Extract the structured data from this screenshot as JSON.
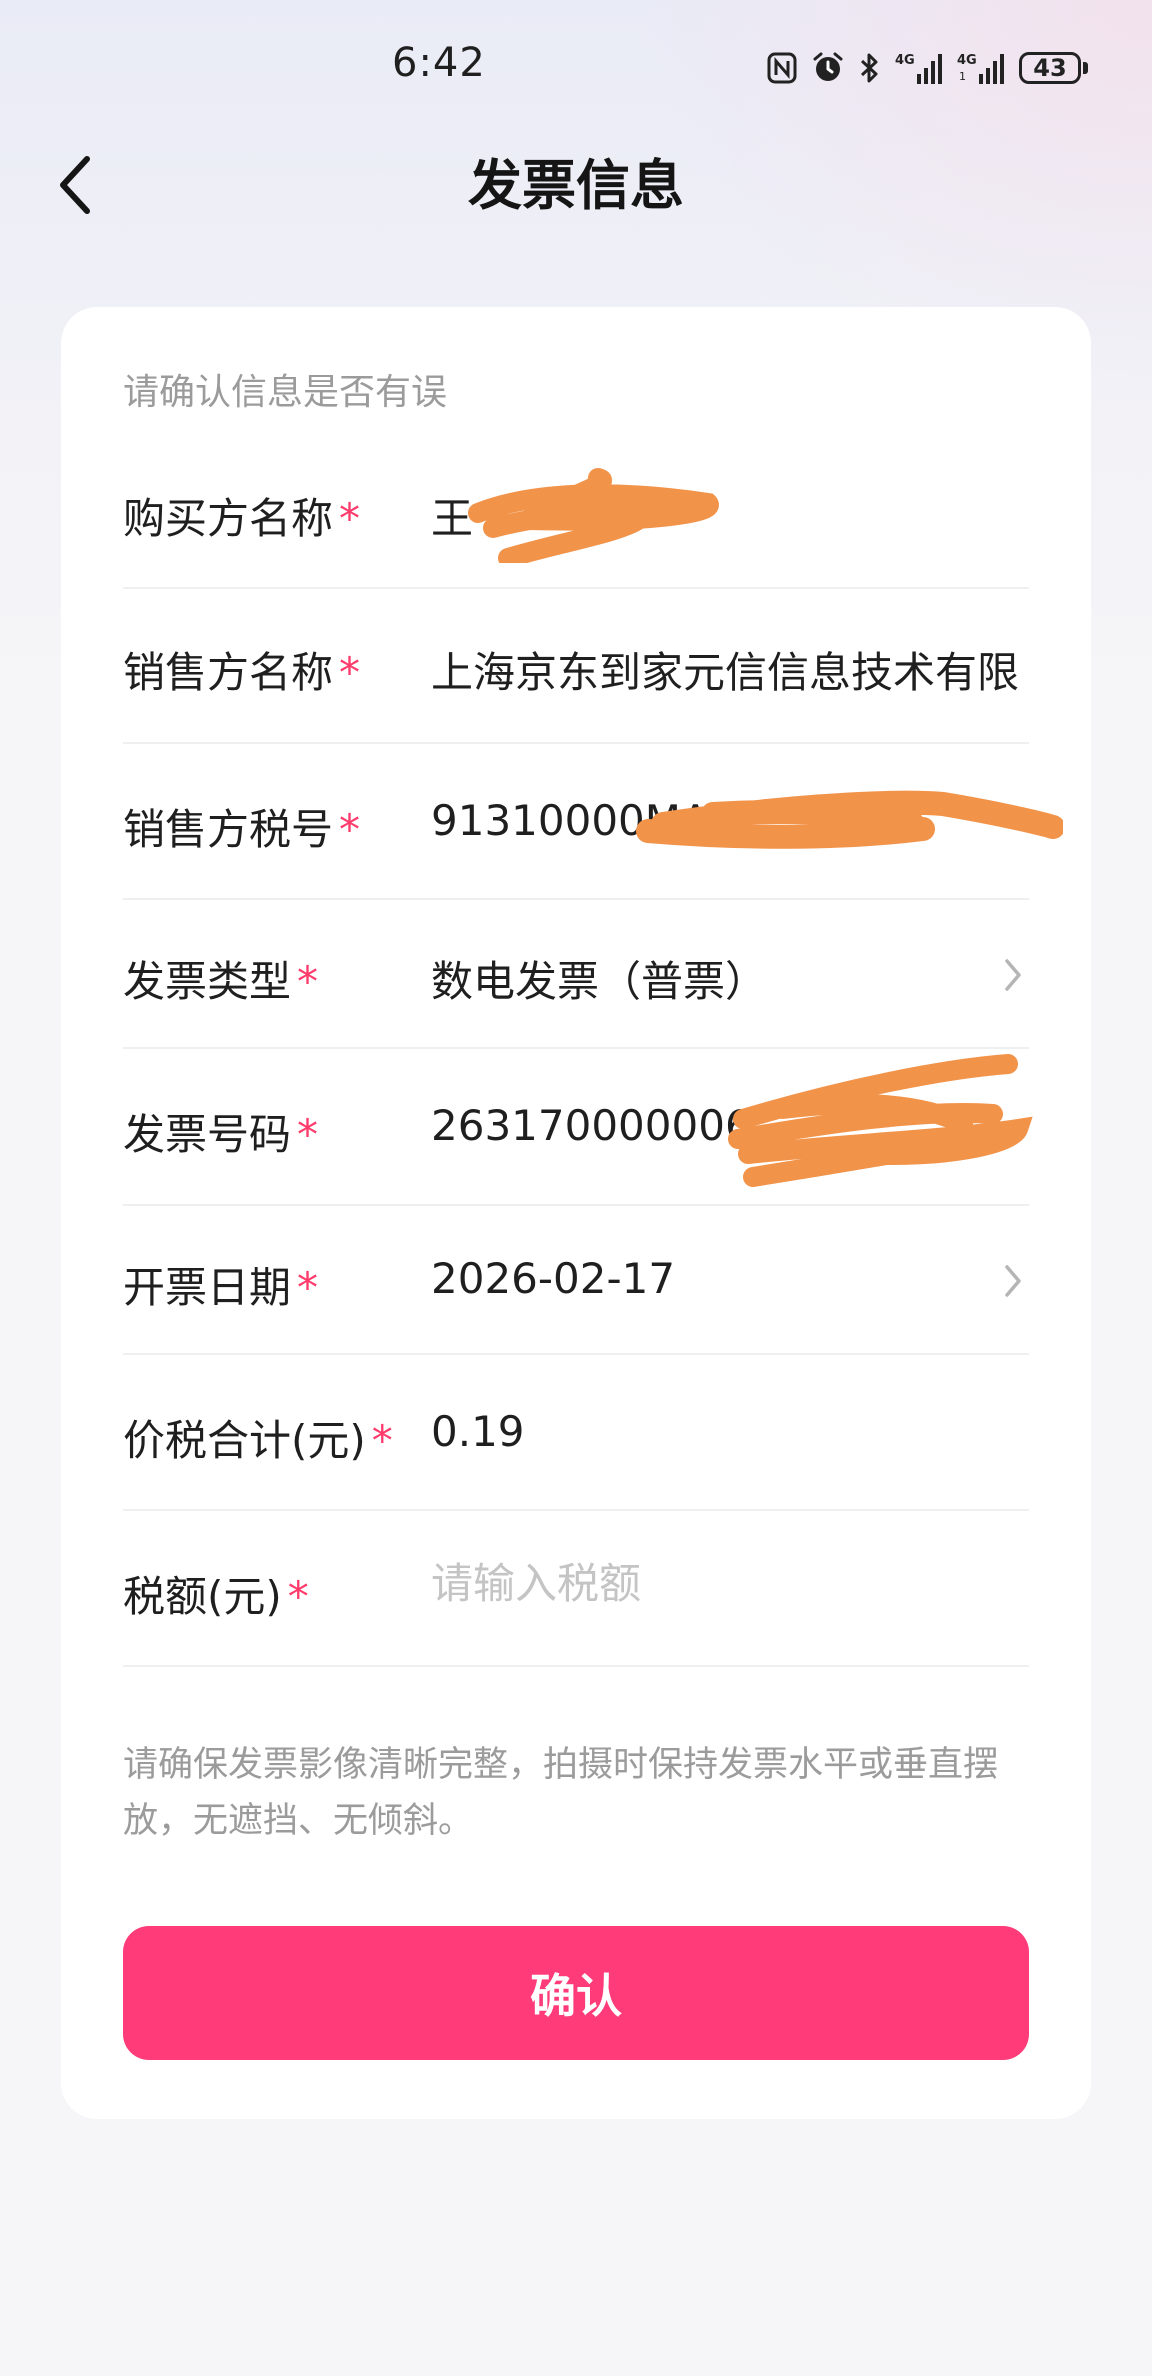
{
  "status_bar": {
    "time": "6:42",
    "battery": "43",
    "icons": [
      "nfc-icon",
      "alarm-icon",
      "bluetooth-icon",
      "signal-4g-icon",
      "signal-4g-icon",
      "battery-icon"
    ]
  },
  "header": {
    "title": "发票信息",
    "back_icon": "chevron-left-icon"
  },
  "card": {
    "hint": "请确认信息是否有误",
    "required_mark": "*",
    "rows": [
      {
        "label": "购买方名称",
        "value": "王",
        "redacted": true
      },
      {
        "label": "销售方名称",
        "value": "上海京东到家元信信息技术有限公司"
      },
      {
        "label": "销售方税号",
        "value": "91310000MA1",
        "redacted": true
      },
      {
        "label": "发票类型",
        "value": "数电发票（普票）",
        "has_chevron": true
      },
      {
        "label": "发票号码",
        "value": "263170000006",
        "redacted": true
      },
      {
        "label": "开票日期",
        "value": "2026-02-17",
        "has_chevron": true
      },
      {
        "label": "价税合计(元)",
        "value": "0.19"
      },
      {
        "label": "税额(元)",
        "value": "",
        "placeholder": "请输入税额"
      }
    ],
    "note": "请确保发票影像清晰完整，拍摄时保持发票水平或垂直摆放，无遮挡、无倾斜。",
    "confirm_label": "确认"
  },
  "colors": {
    "accent": "#ff3b7a",
    "required": "#ff3b6b",
    "redaction": "#f2934a",
    "hint_text": "#9b9b9b"
  }
}
